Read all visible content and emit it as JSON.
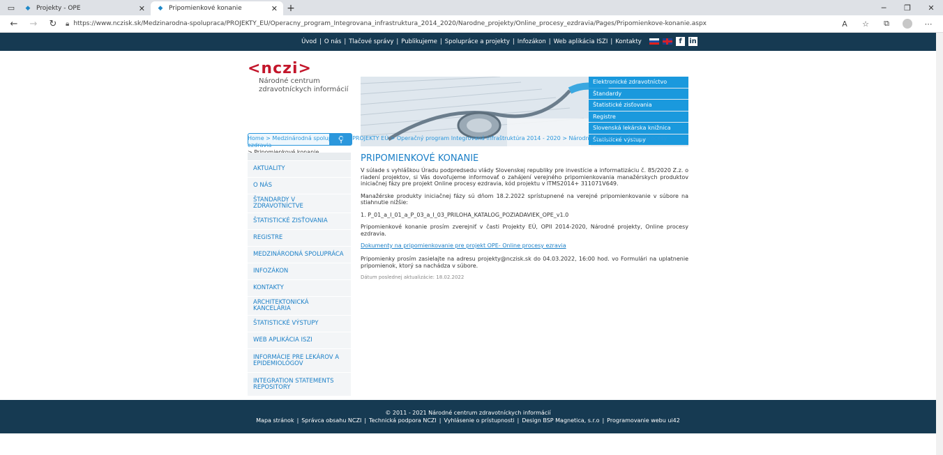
{
  "browser": {
    "tabs": [
      {
        "label": "Projekty - OPE"
      },
      {
        "label": "Pripomienkové konanie"
      }
    ],
    "url": "https://www.nczisk.sk/Medzinarodna-spolupraca/PROJEKTY_EU/Operacny_program_Integrovana_infrastruktura_2014_2020/Narodne_projekty/Online_procesy_ezdravia/Pages/Pripomienkove-konanie.aspx"
  },
  "topnav": {
    "links": [
      "Úvod",
      "O nás",
      "Tlačové správy",
      "Publikujeme",
      "Spolupráce a projekty",
      "Infozákon",
      "Web aplikácia ISZI",
      "Kontakty"
    ]
  },
  "logo": {
    "mark": "<nczi>",
    "line1": "Národné centrum",
    "line2": "zdravotníckych informácií"
  },
  "quick_menu": [
    "Elektronické zdravotníctvo",
    "Štandardy",
    "Štatistické zisťovania",
    "Registre",
    "Slovenská lekárska knižnica",
    "Štatistické výstupy"
  ],
  "breadcrumb": {
    "path": "Home > Medzinárodná spolupráca > PROJEKTY EÚ > Operačný program Integrovaná infraštruktúra 2014 - 2020 > Národné projekty > Online procesy ezdravia",
    "current": "> Pripomienkové konanie"
  },
  "sidemenu": [
    "AKTUALITY",
    "O NÁS",
    "ŠTANDARDY V ZDRAVOTNÍCTVE",
    "ŠTATISTICKÉ ZISŤOVANIA",
    "REGISTRE",
    "MEDZINÁRODNÁ SPOLUPRÁCA",
    "INFOZÁKON",
    "KONTAKTY",
    "ARCHITEKTONICKÁ KANCELÁRIA",
    "ŠTATISTICKÉ VÝSTUPY",
    "WEB APLIKÁCIA ISZI",
    "INFORMÁCIE PRE LEKÁROV A EPIDEMIOLÓGOV",
    "INTEGRATION STATEMENTS REPOSITORY"
  ],
  "content": {
    "title": "PRIPOMIENKOVÉ KONANIE",
    "p1": "V súlade s vyhláškou Úradu podpredsedu vlády Slovenskej republiky pre investície a informatizáciu č. 85/2020 Z.z. o riadení projektov, si Vás dovoľujeme informovať o zahájení verejného pripomienkovania manažérskych produktov iniciačnej fázy pre projekt Online procesy ezdravia, kód projektu v ITMS2014+ 311071V649.",
    "p2": "Manažérske produkty iniciačnej fázy sú dňom 18.2.2022 sprístupnené na verejné pripomienkovanie v súbore na stiahnutie nižšie:",
    "p3": "1. P_01_a_I_01_a_P_03_a_I_03_PRILOHA_KATALOG_POZIADAVIEK_OPE_v1.0",
    "p4": "Pripomienkové konanie prosím zverejniť v časti Projekty EÚ, OPII 2014-2020, Národné projekty, Online procesy ezdravia.",
    "link": "Dokumenty na pripomienkovanie pre projekt OPE- Online procesy ezravia",
    "p5": "Pripomienky prosím zasielajte na adresu projekty@nczisk.sk do 04.03.2022, 16:00 hod. vo Formulári na uplatnenie pripomienok, ktorý sa nachádza v súbore.",
    "date": "Dátum poslednej aktualizácie: 18.02.2022"
  },
  "footer": {
    "copyright": "© 2011 - 2021 Národné centrum zdravotníckych informácií",
    "links": [
      "Mapa stránok",
      "Správca obsahu NCZI",
      "Technická podpora NCZI",
      "Vyhlásenie o prístupnosti",
      "Design BSP Magnetica, s.r.o",
      "Programovanie webu ui42"
    ]
  }
}
